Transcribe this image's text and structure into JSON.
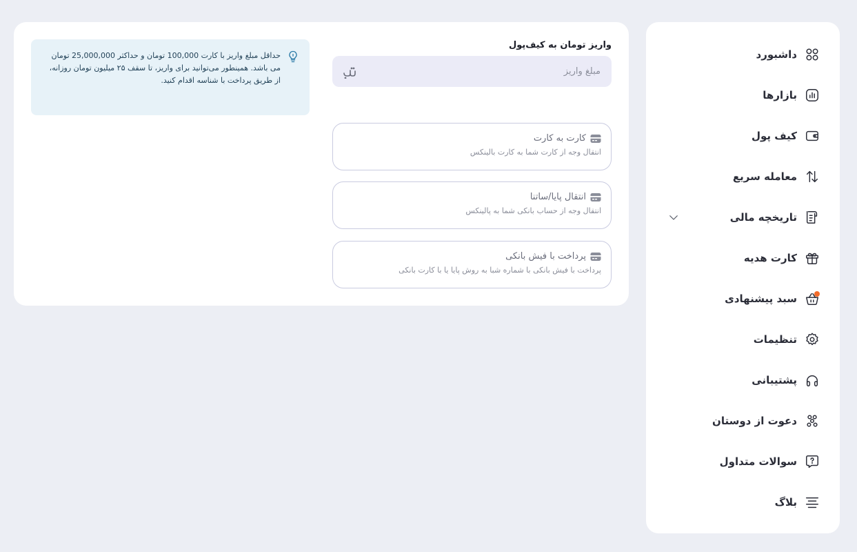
{
  "sidebar": {
    "items": [
      {
        "label": "داشبورد",
        "icon": "dashboard-icon"
      },
      {
        "label": "بازارها",
        "icon": "markets-chart-icon"
      },
      {
        "label": "کیف پول",
        "icon": "wallet-icon"
      },
      {
        "label": "معامله سریع",
        "icon": "swap-arrows-icon"
      },
      {
        "label": "تاریخچه مالی",
        "icon": "receipt-icon",
        "expandable": true
      },
      {
        "label": "کارت هدیه",
        "icon": "gift-icon"
      },
      {
        "label": "سبد پیشنهادی",
        "icon": "basket-icon",
        "badge_color": "#f26b2a"
      },
      {
        "label": "تنظیمات",
        "icon": "gear-icon"
      },
      {
        "label": "پشتیبانی",
        "icon": "headphones-icon"
      },
      {
        "label": "دعوت از دوستان",
        "icon": "referral-icon"
      },
      {
        "label": "سوالات متداول",
        "icon": "question-bubble-icon"
      },
      {
        "label": "بلاگ",
        "icon": "blog-lines-icon"
      }
    ]
  },
  "deposit": {
    "title": "واریز تومان به کیف‌پول",
    "amount_placeholder": "مبلغ واریز",
    "currency_icon": "toman-icon"
  },
  "methods": [
    {
      "title": "کارت به کارت",
      "desc": "انتقال وجه از کارت شما به کارت بالینکس",
      "icon": "card-icon"
    },
    {
      "title": "انتقال پایا/ساتنا",
      "desc": "انتقال وجه از حساب بانکی شما به پالینکس",
      "icon": "card-icon"
    },
    {
      "title": "پرداخت با فیش بانکی",
      "desc": "پرداخت با فیش بانکی با شماره شبا به روش پایا یا با کارت بانکی",
      "icon": "card-icon"
    }
  ],
  "info": {
    "text": "حداقل مبلغ واریز با کارت 100,000 تومان و حداکثر 25,000,000 تومان می باشد. همینطور می‌توانید برای واریز، تا سقف ۲۵ میلیون تومان روزانه، از طریق پرداخت با شناسه اقدام کنید.",
    "icon": "lightbulb-icon"
  },
  "colors": {
    "background": "#eceef4",
    "card": "#ffffff",
    "input_bg": "#ebebf7",
    "info_bg": "#e7f2f8",
    "notification": "#f26b2a"
  }
}
